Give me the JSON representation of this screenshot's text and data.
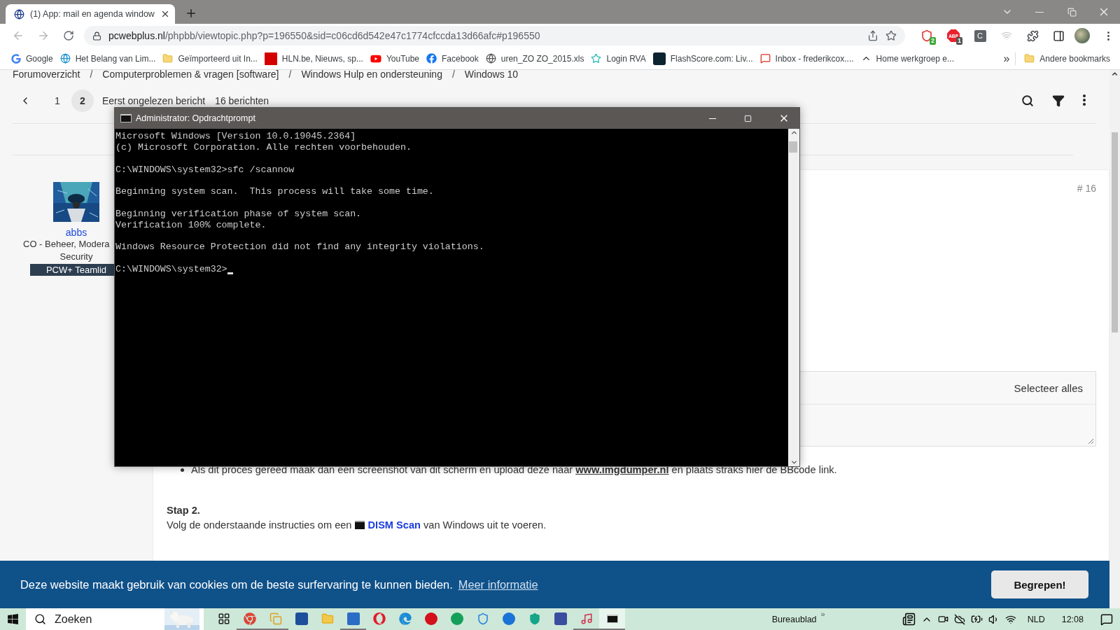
{
  "browser": {
    "tab": {
      "title": "(1) App: mail en agenda window",
      "selected": true
    },
    "back": {
      "disabled": true
    },
    "forward": {
      "disabled": true
    },
    "address": {
      "host": "pcwebplus.nl",
      "path": "/phpbb/viewtopic.php?p=196550&sid=c06cd6d542e47c1774cfccda13d66afc#p196550"
    },
    "extensions": [
      {
        "kind": "shield",
        "badge": "2"
      },
      {
        "kind": "stop",
        "label": "ABP",
        "badge": "1"
      },
      {
        "kind": "letter",
        "label": "C"
      },
      {
        "kind": "faint"
      }
    ],
    "bookmarks": [
      {
        "label": "Google"
      },
      {
        "label": "Het Belang van Lim..."
      },
      {
        "label": "Geïmporteerd uit In..."
      },
      {
        "label": "HLN.be, Nieuws, sp..."
      },
      {
        "label": "YouTube"
      },
      {
        "label": "Facebook"
      },
      {
        "label": "uren_ZO ZO_2015.xls"
      },
      {
        "label": "Login RVA"
      },
      {
        "label": "FlashScore.com: Liv..."
      },
      {
        "label": "Inbox - frederikcox...."
      },
      {
        "label": "Home werkgroep e..."
      }
    ],
    "bookmarks_more": "»",
    "other_bookmarks": "Andere bookmarks"
  },
  "page": {
    "breadcrumb": {
      "separator": "/",
      "items": [
        "Forumoverzicht",
        "Computerproblemen & vragen [software]",
        "Windows Hulp en ondersteuning",
        "Windows 10"
      ]
    },
    "pagination": {
      "pages": [
        {
          "label": "1",
          "selected": false
        },
        {
          "label": "2",
          "selected": true
        }
      ],
      "first_unread": "Eerst ongelezen bericht",
      "count": "16 berichten"
    },
    "post": {
      "author": "abbs",
      "role_lines": [
        "CO - Beheer, Modera",
        "Security"
      ],
      "rank": "PCW+ Teamlid",
      "number": "# 16",
      "code_box": {
        "select_all": "Selecteer alles"
      },
      "bullet": {
        "before": "Als dit proces gereed maak dan een screenshot van dit scherm en upload deze naar",
        "link": "www.imgdumper.nl",
        "after": "en plaats straks hier de BBcode link."
      },
      "step": {
        "title": "Stap 2.",
        "before": "Volg de onderstaande instructies om een",
        "link": "DISM Scan",
        "after": "van Windows uit te voeren."
      }
    }
  },
  "cookie_banner": {
    "text": "Deze website maakt gebruik van cookies om de beste surfervaring te kunnen bieden.",
    "link": "Meer informatie",
    "button": "Begrepen!"
  },
  "console": {
    "title": "Administrator: Opdrachtprompt",
    "blocks": [
      [
        "Microsoft Windows [Version 10.0.19045.2364]",
        "(c) Microsoft Corporation. Alle rechten voorbehouden."
      ],
      [
        "C:\\WINDOWS\\system32>sfc /scannow"
      ],
      [
        "Beginning system scan.  This process will take some time."
      ],
      [
        "Beginning verification phase of system scan.",
        "Verification 100% complete."
      ],
      [
        "Windows Resource Protection did not find any integrity violations."
      ],
      [
        "C:\\WINDOWS\\system32>"
      ]
    ],
    "cursor": true
  },
  "taskbar": {
    "search_placeholder": "Zoeken",
    "apps": [
      {
        "running": false,
        "active": false
      },
      {
        "running": true,
        "active": false
      },
      {
        "running": true,
        "active": false
      },
      {
        "running": false,
        "active": false
      },
      {
        "running": false,
        "active": false
      },
      {
        "running": true,
        "active": false
      },
      {
        "running": false,
        "active": false
      },
      {
        "running": false,
        "active": false
      },
      {
        "running": false,
        "active": false
      },
      {
        "running": false,
        "active": false
      },
      {
        "running": false,
        "active": false
      },
      {
        "running": false,
        "active": false
      },
      {
        "running": false,
        "active": false
      },
      {
        "running": false,
        "active": false
      },
      {
        "running": true,
        "active": false
      },
      {
        "running": true,
        "active": true
      }
    ],
    "desktop": "Bureaublad",
    "desktop_more": "»",
    "language": "NLD",
    "time": "12:08"
  }
}
